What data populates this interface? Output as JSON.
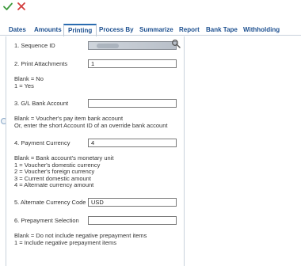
{
  "toolbar": {
    "ok_icon": "checkmark-icon",
    "cancel_icon": "close-icon",
    "ok_color": "#3c9a3c",
    "cancel_color": "#d23c3c"
  },
  "tabs": [
    {
      "label": "Dates"
    },
    {
      "label": "Amounts"
    },
    {
      "label": "Printing",
      "active": true
    },
    {
      "label": "Process By"
    },
    {
      "label": "Summarize"
    },
    {
      "label": "Report"
    },
    {
      "label": "Bank Tape"
    },
    {
      "label": "Withholding"
    }
  ],
  "form": {
    "sequence_id": {
      "label": "1. Sequence ID",
      "value": ""
    },
    "print_attachments": {
      "label": "2. Print Attachments",
      "value": "1",
      "help": [
        "Blank = No",
        "1 = Yes"
      ]
    },
    "gl_bank_account": {
      "label": "3. G/L Bank Account",
      "value": "",
      "help": [
        "Blank = Voucher's pay item bank account",
        "Or, enter the short Account ID of an override bank account"
      ]
    },
    "payment_currency": {
      "label": "4. Payment Currency",
      "value": "4",
      "help": [
        "Blank = Bank account's monetary unit",
        "1 = Voucher's domestic currency",
        "2 = Voucher's foreign currency",
        "3 = Current domestic amount",
        "4 = Alternate currency amount"
      ]
    },
    "alternate_currency_code": {
      "label": "5. Alternate Currency Code",
      "value": "USD"
    },
    "prepayment_selection": {
      "label": "6. Prepayment Selection",
      "value": "",
      "help": [
        "Blank = Do not include negative prepayment items",
        "1 = Include negative prepayment items"
      ]
    }
  },
  "icons": {
    "search": "search-icon"
  }
}
